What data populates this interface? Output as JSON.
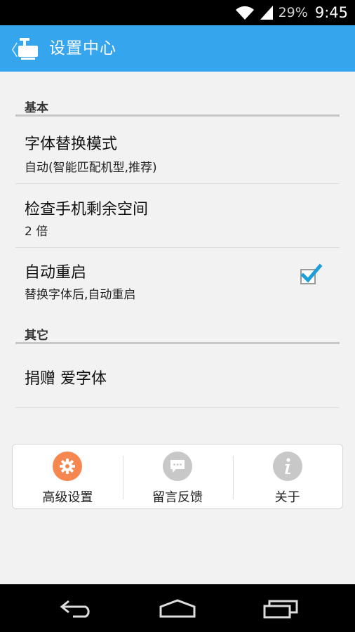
{
  "status_bar": {
    "battery": "29%",
    "time": "9:45"
  },
  "action_bar": {
    "back": "〈",
    "title": "设置中心",
    "icon": "app-logo-icon"
  },
  "sections": [
    {
      "header": "基本"
    },
    {
      "header": "其它"
    }
  ],
  "prefs": {
    "font_mode": {
      "title": "字体替换模式",
      "summary": "自动(智能匹配机型,推荐)"
    },
    "storage": {
      "title": "检查手机剩余空间",
      "summary": "2 倍"
    },
    "auto_reboot": {
      "title": "自动重启",
      "summary": "替换字体后,自动重启",
      "checked": true
    },
    "donate": {
      "title": "捐赠 爱字体"
    }
  },
  "bottom_panel": [
    {
      "label": "高级设置",
      "icon": "gear-icon",
      "color": "#f5874f"
    },
    {
      "label": "留言反馈",
      "icon": "chat-bubble-icon",
      "color": "#c8c8c8"
    },
    {
      "label": "关于",
      "icon": "info-icon",
      "color": "#c8c8c8"
    }
  ],
  "colors": {
    "accent": "#35a6ee",
    "check": "#1f9fd8"
  }
}
